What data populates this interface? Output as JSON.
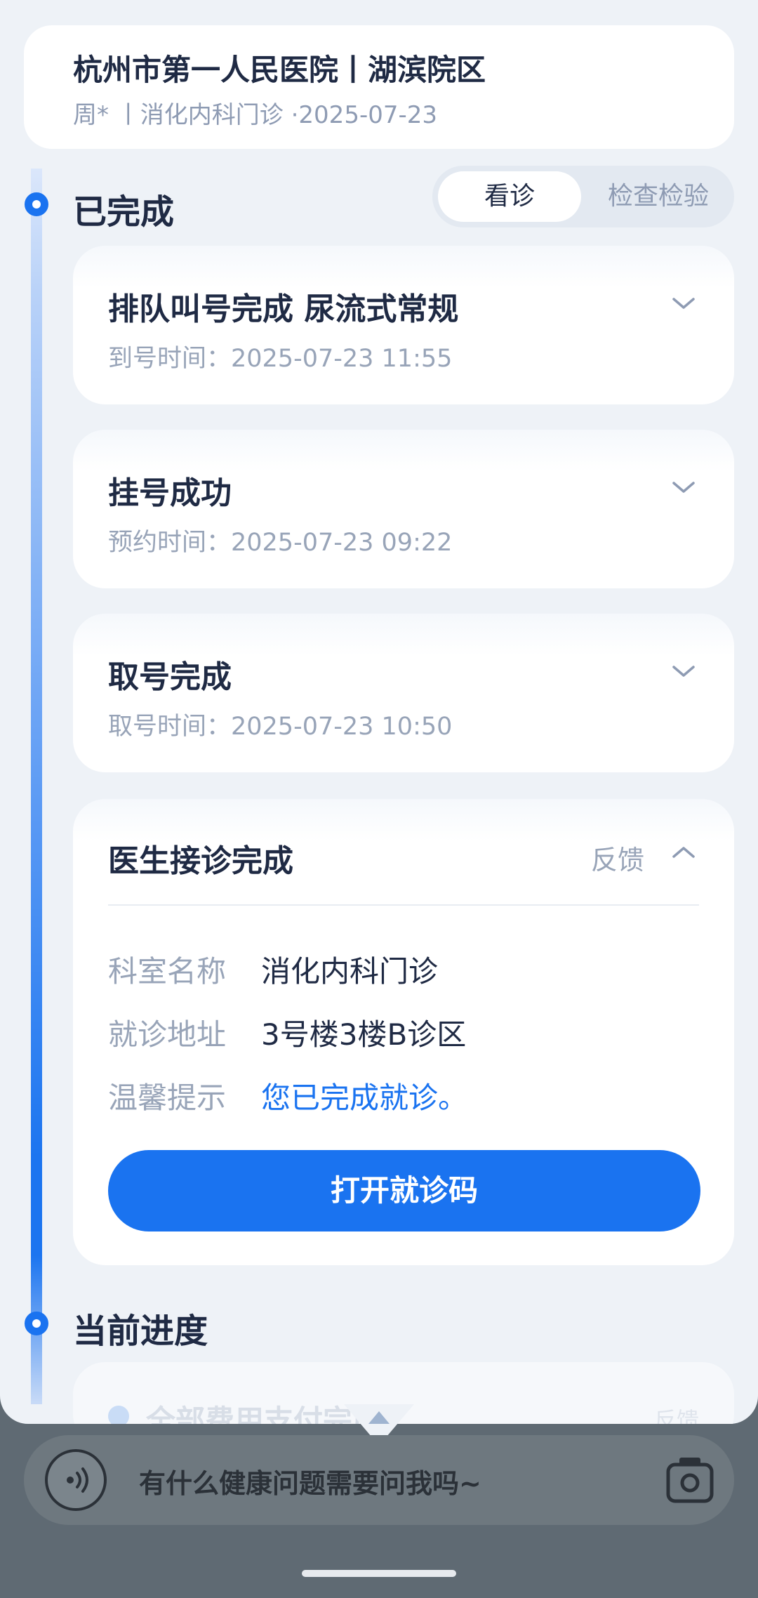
{
  "header": {
    "hospital_name": "杭州市第一人民医院丨湖滨院区",
    "subtitle": "周*  丨消化内科门诊 ·2025-07-23"
  },
  "sections": {
    "completed_title": "已完成",
    "current_title": "当前进度"
  },
  "tabs": [
    {
      "label": "看诊",
      "active": true
    },
    {
      "label": "检查检验",
      "active": false
    }
  ],
  "cards": [
    {
      "title": "排队叫号完成 尿流式常规",
      "subtitle": "到号时间：2025-07-23 11:55"
    },
    {
      "title": "挂号成功",
      "subtitle": "预约时间：2025-07-23 09:22"
    },
    {
      "title": "取号完成",
      "subtitle": "取号时间：2025-07-23 10:50"
    }
  ],
  "doctor_card": {
    "title": "医生接诊完成",
    "feedback": "反馈",
    "rows": [
      {
        "label": "科室名称",
        "value": "消化内科门诊"
      },
      {
        "label": "就诊地址",
        "value": "3号楼3楼B诊区"
      },
      {
        "label": "温馨提示",
        "value": "您已完成就诊。"
      }
    ],
    "button": "打开就诊码"
  },
  "peek_card": {
    "title": "全部费用支付完成",
    "right": "反馈"
  },
  "input": {
    "placeholder": "有什么健康问题需要问我吗~"
  },
  "colors": {
    "accent": "#1a73f0",
    "background": "#eef2f7",
    "title_text": "#1f2a44",
    "muted_text": "#98a4b8"
  },
  "icons": [
    "chevron-down-icon",
    "chevron-up-icon",
    "voice-icon",
    "camera-icon",
    "collapse-arrow-icon"
  ]
}
